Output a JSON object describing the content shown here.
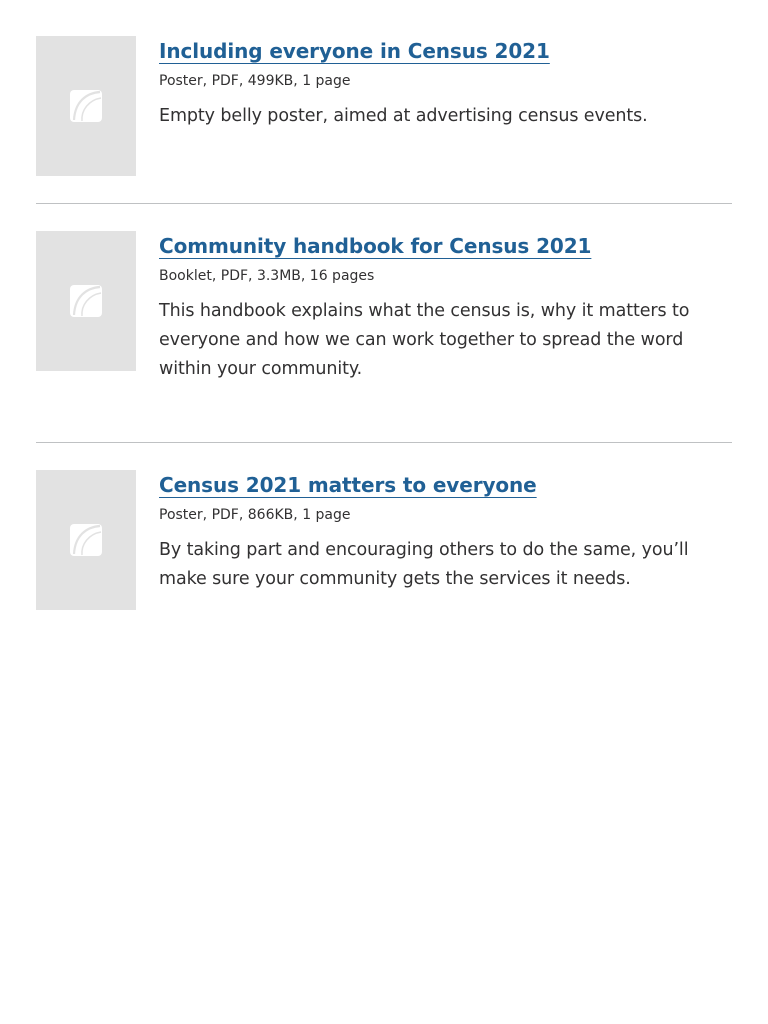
{
  "documents": [
    {
      "title": "Including everyone in Census 2021",
      "type": "Poster",
      "format": "PDF",
      "size": "499KB",
      "length": "1 page",
      "description": "Empty belly poster, aimed at advertising census events.",
      "thumbnail_icon": "document-placeholder-icon"
    },
    {
      "title": "Community handbook for Census 2021",
      "type": "Booklet",
      "format": "PDF",
      "size": "3.3MB",
      "length": "16 pages",
      "description": "This handbook explains what the census is, why it matters to everyone and how we can work together to spread the word within your community.",
      "thumbnail_icon": "document-placeholder-icon"
    },
    {
      "title": "Census 2021 matters to everyone",
      "type": "Poster",
      "format": "PDF",
      "size": "866KB",
      "length": "1 page",
      "description": "By taking part and encouraging others to do the same, you’ll make sure your community gets the services it needs.",
      "thumbnail_icon": "document-placeholder-icon"
    }
  ],
  "colors": {
    "link": "#206095",
    "text": "#323132",
    "thumbnail_bg": "#e2e2e2",
    "divider": "#bfc1c3"
  }
}
